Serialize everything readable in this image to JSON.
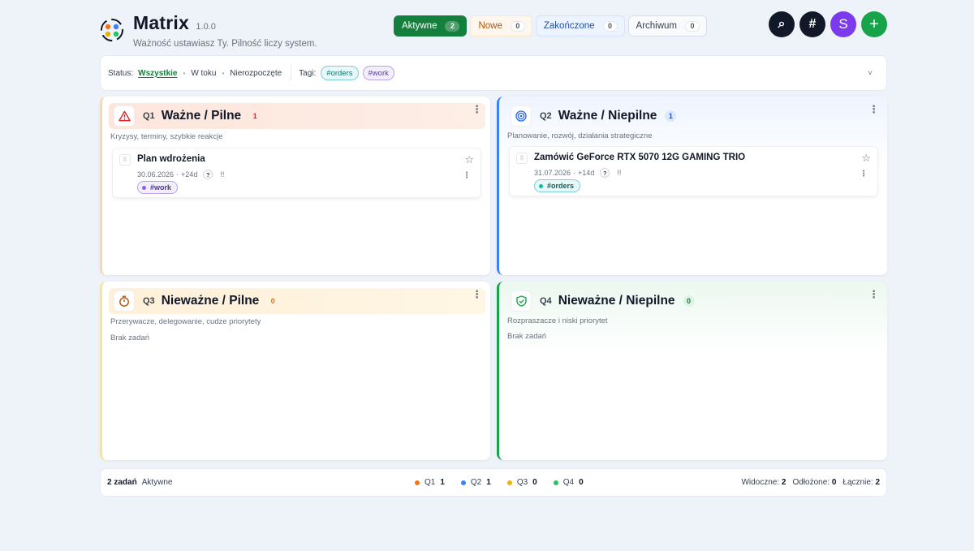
{
  "app": {
    "title": "Matrix",
    "version": "1.0.0",
    "subtitle": "Ważność ustawiasz Ty. Pilność liczy system."
  },
  "view_tabs": [
    {
      "label": "Aktywne",
      "count": "2"
    },
    {
      "label": "Nowe",
      "count": "0"
    },
    {
      "label": "Zakończone",
      "count": "0"
    },
    {
      "label": "Archiwum",
      "count": "0"
    }
  ],
  "actions": {
    "search_glyph": "⌕",
    "tags_glyph": "#",
    "avatar_letter": "S",
    "add_glyph": "+"
  },
  "filters": {
    "status_label": "Status:",
    "status_options": [
      "Wszystkie",
      "W toku",
      "Nierozpoczęte"
    ],
    "tags_label": "Tagi:",
    "tags": [
      "#orders",
      "#work"
    ],
    "expand_glyph": "˅"
  },
  "quadrants": [
    {
      "code": "Q1",
      "title": "Ważne / Pilne",
      "count": "1",
      "desc": "Kryzysy, terminy, szybkie reakcje",
      "accent": "#dc2626",
      "task": {
        "title": "Plan wdrożenia",
        "date": "30.06.2026",
        "delta": "+24d",
        "tag": "#work"
      }
    },
    {
      "code": "Q2",
      "title": "Ważne / Niepilne",
      "count": "1",
      "desc": "Planowanie, rozwój, działania strategiczne",
      "accent": "#2563eb",
      "task": {
        "title": "Zamówić GeForce RTX 5070 12G GAMING TRIO",
        "date": "31.07.2026",
        "delta": "+14d",
        "tag": "#orders"
      }
    },
    {
      "code": "Q3",
      "title": "Nieważne / Pilne",
      "count": "0",
      "desc": "Przerywacze, delegowanie, cudze priorytety",
      "accent": "#d97706",
      "empty": "Brak zadań"
    },
    {
      "code": "Q4",
      "title": "Nieważne / Niepilne",
      "count": "0",
      "desc": "Rozpraszacze i niski priorytet",
      "accent": "#16a34a",
      "empty": "Brak zadań"
    }
  ],
  "task_ui": {
    "help_glyph": "?",
    "priority_glyph": "!!"
  },
  "footer": {
    "task_count": "2 zadań",
    "view_name": "Aktywne",
    "legend": [
      {
        "label": "Q1",
        "value": "1",
        "color": "#f97316"
      },
      {
        "label": "Q2",
        "value": "1",
        "color": "#3b82f6"
      },
      {
        "label": "Q3",
        "value": "0",
        "color": "#eab308"
      },
      {
        "label": "Q4",
        "value": "0",
        "color": "#22c55e"
      }
    ],
    "visible_label": "Widoczne:",
    "visible_value": "2",
    "postponed_label": "Odłożone:",
    "postponed_value": "0",
    "total_label": "Łącznie:",
    "total_value": "2"
  }
}
